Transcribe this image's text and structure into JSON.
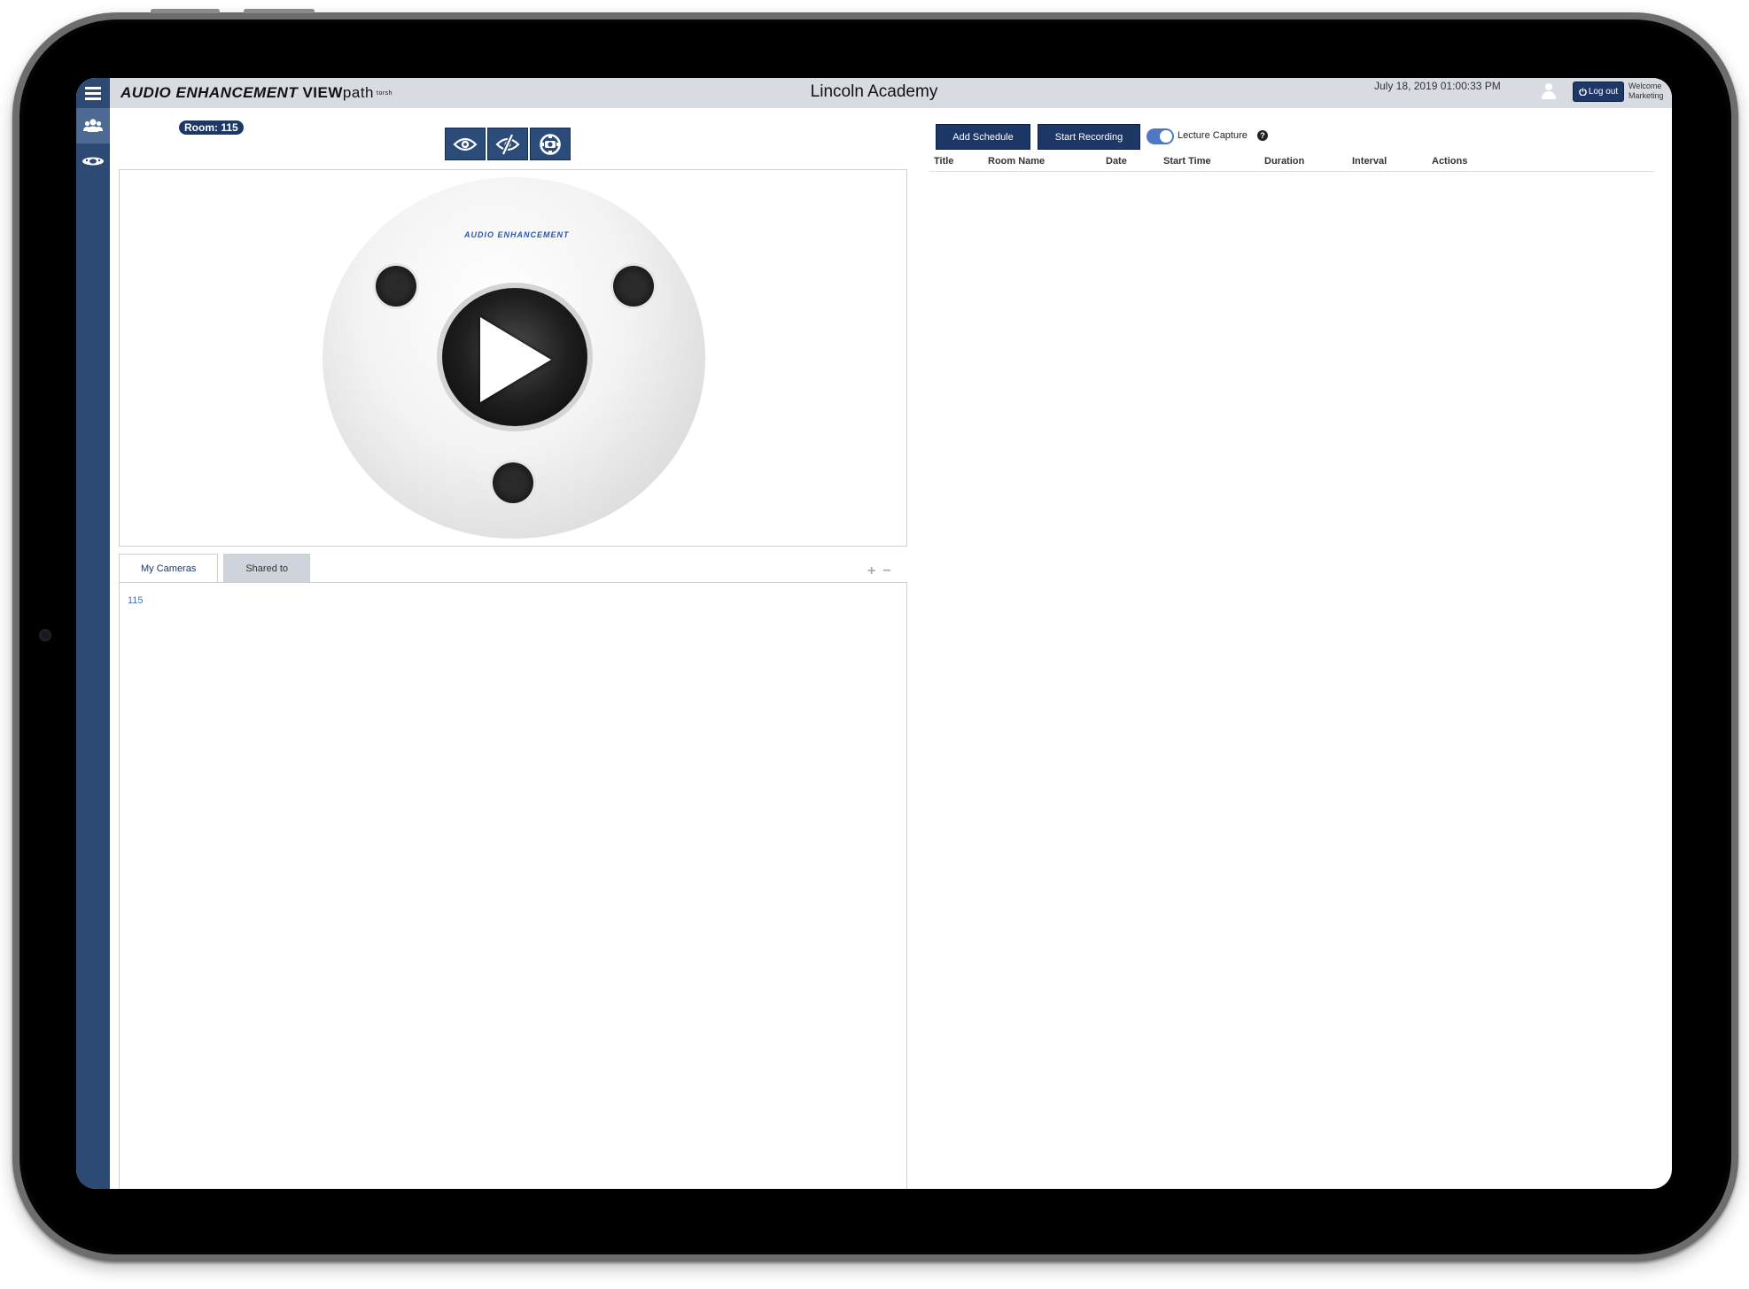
{
  "header": {
    "brand_part1": "AUDIO ENHANCEMENT",
    "brand_part2": "VIEW",
    "brand_part3": "path",
    "brand_part4": "torsh",
    "title": "Lincoln Academy",
    "datetime": "July 18, 2019 01:00:33 PM",
    "logout_label": "Log out",
    "welcome_line1": "Welcome",
    "welcome_line2": "Marketing"
  },
  "sidebar": {
    "items": [
      {
        "icon": "users-icon"
      },
      {
        "icon": "camera-icon"
      }
    ]
  },
  "camera_panel": {
    "room_badge": "Room: 115",
    "controls": [
      {
        "icon": "eye-icon"
      },
      {
        "icon": "eye-slash-icon"
      },
      {
        "icon": "ptz-control-icon"
      }
    ],
    "video_logo": "AUDIO ENHANCEMENT",
    "tabs": [
      "My Cameras",
      "Shared to"
    ],
    "zoom_in": "+",
    "zoom_out": "−",
    "cameras": [
      "115"
    ]
  },
  "schedule": {
    "add_schedule_label": "Add Schedule",
    "start_recording_label": "Start Recording",
    "lecture_capture_label": "Lecture Capture",
    "lecture_capture_on": true,
    "columns": [
      "Title",
      "Room Name",
      "Date",
      "Start Time",
      "Duration",
      "Interval",
      "Actions"
    ],
    "rows": []
  },
  "colors": {
    "navy": "#1d3766",
    "sidebar": "#2c4a74",
    "topbar": "#d8dbe2",
    "toggle": "#4f78c4"
  }
}
